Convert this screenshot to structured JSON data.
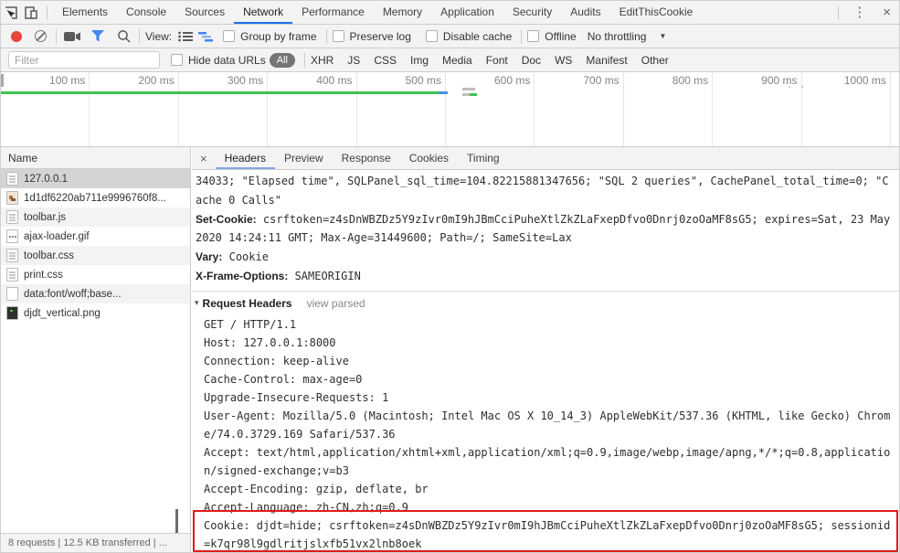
{
  "window": {
    "menu_glyph": "⋮",
    "close_glyph": "×"
  },
  "tabs": {
    "main": [
      "Elements",
      "Console",
      "Sources",
      "Network",
      "Performance",
      "Memory",
      "Application",
      "Security",
      "Audits",
      "EditThisCookie"
    ],
    "selected": "Network"
  },
  "toolbar": {
    "view_label": "View:",
    "group_by_frame": "Group by frame",
    "preserve_log": "Preserve log",
    "disable_cache": "Disable cache",
    "offline": "Offline",
    "throttling": "No throttling",
    "throttling_caret": "▼"
  },
  "filterbar": {
    "placeholder": "Filter",
    "hide_data_urls": "Hide data URLs",
    "all_pill": "All",
    "types": [
      "XHR",
      "JS",
      "CSS",
      "Img",
      "Media",
      "Font",
      "Doc",
      "WS",
      "Manifest",
      "Other"
    ]
  },
  "overview": {
    "ticks": [
      "100 ms",
      "200 ms",
      "300 ms",
      "400 ms",
      "500 ms",
      "600 ms",
      "700 ms",
      "800 ms",
      "900 ms",
      "1000 ms"
    ]
  },
  "requests": {
    "column_header": "Name",
    "selected_index": 0,
    "rows": [
      {
        "name": "127.0.0.1",
        "icon": "document-icon"
      },
      {
        "name": "1d1df6220ab711e9996760f8...",
        "icon": "image-icon"
      },
      {
        "name": "toolbar.js",
        "icon": "document-icon"
      },
      {
        "name": "ajax-loader.gif",
        "icon": "image-icon"
      },
      {
        "name": "toolbar.css",
        "icon": "document-icon"
      },
      {
        "name": "print.css",
        "icon": "document-icon"
      },
      {
        "name": "data:font/woff;base...",
        "icon": "file-icon"
      },
      {
        "name": "djdt_vertical.png",
        "icon": "image-icon"
      }
    ]
  },
  "details": {
    "close_glyph": "×",
    "tabs": [
      "Headers",
      "Preview",
      "Response",
      "Cookies",
      "Timing"
    ],
    "selected_tab": "Headers",
    "response_overflow": "34033; \"Elapsed time\", SQLPanel_sql_time=104.82215881347656; \"SQL 2 queries\", CachePanel_total_time=0; \"Cache 0 Calls\"",
    "response_headers": [
      {
        "name": "Set-Cookie:",
        "value": "csrftoken=z4sDnWBZDz5Y9zIvr0mI9hJBmCciPuheXtlZkZLaFxepDfvo0Dnrj0zoOaMF8sG5; expires=Sat, 23 May 2020 14:24:11 GMT; Max-Age=31449600; Path=/; SameSite=Lax"
      },
      {
        "name": "Vary:",
        "value": "Cookie"
      },
      {
        "name": "X-Frame-Options:",
        "value": "SAMEORIGIN"
      }
    ],
    "request_headers": {
      "disclosure": "▾",
      "title": "Request Headers",
      "action": "view parsed",
      "raw_lines": [
        "GET / HTTP/1.1",
        "Host: 127.0.0.1:8000",
        "Connection: keep-alive",
        "Cache-Control: max-age=0",
        "Upgrade-Insecure-Requests: 1",
        "User-Agent: Mozilla/5.0 (Macintosh; Intel Mac OS X 10_14_3) AppleWebKit/537.36 (KHTML, like Gecko) Chrome/74.0.3729.169 Safari/537.36",
        "Accept: text/html,application/xhtml+xml,application/xml;q=0.9,image/webp,image/apng,*/*;q=0.8,application/signed-exchange;v=b3",
        "Accept-Encoding: gzip, deflate, br",
        "Accept-Language: zh-CN,zh;q=0.9",
        "Cookie: djdt=hide; csrftoken=z4sDnWBZDz5Y9zIvr0mI9hJBmCciPuheXtlZkZLaFxepDfvo0Dnrj0zoOaMF8sG5; sessionid=k7qr98l9gdlritjslxfb51vx2lnb8oek"
      ],
      "highlighted_header": "Cookie"
    }
  },
  "statusbar": {
    "text": "8 requests | 12.5 KB transferred | ..."
  },
  "colors": {
    "accent_blue": "#1a73e8",
    "icon_blue": "#4285f4",
    "record_red": "#e8453c",
    "highlight_red": "#df1b1b",
    "overview_green": "#3fc450"
  }
}
